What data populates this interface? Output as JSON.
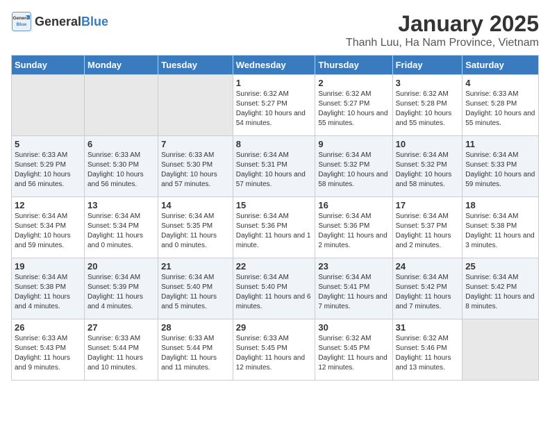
{
  "header": {
    "logo_general": "General",
    "logo_blue": "Blue",
    "title": "January 2025",
    "subtitle": "Thanh Luu, Ha Nam Province, Vietnam"
  },
  "columns": [
    "Sunday",
    "Monday",
    "Tuesday",
    "Wednesday",
    "Thursday",
    "Friday",
    "Saturday"
  ],
  "weeks": [
    [
      {
        "day": "",
        "sunrise": "",
        "sunset": "",
        "daylight": "",
        "empty": true
      },
      {
        "day": "",
        "sunrise": "",
        "sunset": "",
        "daylight": "",
        "empty": true
      },
      {
        "day": "",
        "sunrise": "",
        "sunset": "",
        "daylight": "",
        "empty": true
      },
      {
        "day": "1",
        "sunrise": "Sunrise: 6:32 AM",
        "sunset": "Sunset: 5:27 PM",
        "daylight": "Daylight: 10 hours and 54 minutes."
      },
      {
        "day": "2",
        "sunrise": "Sunrise: 6:32 AM",
        "sunset": "Sunset: 5:27 PM",
        "daylight": "Daylight: 10 hours and 55 minutes."
      },
      {
        "day": "3",
        "sunrise": "Sunrise: 6:32 AM",
        "sunset": "Sunset: 5:28 PM",
        "daylight": "Daylight: 10 hours and 55 minutes."
      },
      {
        "day": "4",
        "sunrise": "Sunrise: 6:33 AM",
        "sunset": "Sunset: 5:28 PM",
        "daylight": "Daylight: 10 hours and 55 minutes."
      }
    ],
    [
      {
        "day": "5",
        "sunrise": "Sunrise: 6:33 AM",
        "sunset": "Sunset: 5:29 PM",
        "daylight": "Daylight: 10 hours and 56 minutes."
      },
      {
        "day": "6",
        "sunrise": "Sunrise: 6:33 AM",
        "sunset": "Sunset: 5:30 PM",
        "daylight": "Daylight: 10 hours and 56 minutes."
      },
      {
        "day": "7",
        "sunrise": "Sunrise: 6:33 AM",
        "sunset": "Sunset: 5:30 PM",
        "daylight": "Daylight: 10 hours and 57 minutes."
      },
      {
        "day": "8",
        "sunrise": "Sunrise: 6:34 AM",
        "sunset": "Sunset: 5:31 PM",
        "daylight": "Daylight: 10 hours and 57 minutes."
      },
      {
        "day": "9",
        "sunrise": "Sunrise: 6:34 AM",
        "sunset": "Sunset: 5:32 PM",
        "daylight": "Daylight: 10 hours and 58 minutes."
      },
      {
        "day": "10",
        "sunrise": "Sunrise: 6:34 AM",
        "sunset": "Sunset: 5:32 PM",
        "daylight": "Daylight: 10 hours and 58 minutes."
      },
      {
        "day": "11",
        "sunrise": "Sunrise: 6:34 AM",
        "sunset": "Sunset: 5:33 PM",
        "daylight": "Daylight: 10 hours and 59 minutes."
      }
    ],
    [
      {
        "day": "12",
        "sunrise": "Sunrise: 6:34 AM",
        "sunset": "Sunset: 5:34 PM",
        "daylight": "Daylight: 10 hours and 59 minutes."
      },
      {
        "day": "13",
        "sunrise": "Sunrise: 6:34 AM",
        "sunset": "Sunset: 5:34 PM",
        "daylight": "Daylight: 11 hours and 0 minutes."
      },
      {
        "day": "14",
        "sunrise": "Sunrise: 6:34 AM",
        "sunset": "Sunset: 5:35 PM",
        "daylight": "Daylight: 11 hours and 0 minutes."
      },
      {
        "day": "15",
        "sunrise": "Sunrise: 6:34 AM",
        "sunset": "Sunset: 5:36 PM",
        "daylight": "Daylight: 11 hours and 1 minute."
      },
      {
        "day": "16",
        "sunrise": "Sunrise: 6:34 AM",
        "sunset": "Sunset: 5:36 PM",
        "daylight": "Daylight: 11 hours and 2 minutes."
      },
      {
        "day": "17",
        "sunrise": "Sunrise: 6:34 AM",
        "sunset": "Sunset: 5:37 PM",
        "daylight": "Daylight: 11 hours and 2 minutes."
      },
      {
        "day": "18",
        "sunrise": "Sunrise: 6:34 AM",
        "sunset": "Sunset: 5:38 PM",
        "daylight": "Daylight: 11 hours and 3 minutes."
      }
    ],
    [
      {
        "day": "19",
        "sunrise": "Sunrise: 6:34 AM",
        "sunset": "Sunset: 5:38 PM",
        "daylight": "Daylight: 11 hours and 4 minutes."
      },
      {
        "day": "20",
        "sunrise": "Sunrise: 6:34 AM",
        "sunset": "Sunset: 5:39 PM",
        "daylight": "Daylight: 11 hours and 4 minutes."
      },
      {
        "day": "21",
        "sunrise": "Sunrise: 6:34 AM",
        "sunset": "Sunset: 5:40 PM",
        "daylight": "Daylight: 11 hours and 5 minutes."
      },
      {
        "day": "22",
        "sunrise": "Sunrise: 6:34 AM",
        "sunset": "Sunset: 5:40 PM",
        "daylight": "Daylight: 11 hours and 6 minutes."
      },
      {
        "day": "23",
        "sunrise": "Sunrise: 6:34 AM",
        "sunset": "Sunset: 5:41 PM",
        "daylight": "Daylight: 11 hours and 7 minutes."
      },
      {
        "day": "24",
        "sunrise": "Sunrise: 6:34 AM",
        "sunset": "Sunset: 5:42 PM",
        "daylight": "Daylight: 11 hours and 7 minutes."
      },
      {
        "day": "25",
        "sunrise": "Sunrise: 6:34 AM",
        "sunset": "Sunset: 5:42 PM",
        "daylight": "Daylight: 11 hours and 8 minutes."
      }
    ],
    [
      {
        "day": "26",
        "sunrise": "Sunrise: 6:33 AM",
        "sunset": "Sunset: 5:43 PM",
        "daylight": "Daylight: 11 hours and 9 minutes."
      },
      {
        "day": "27",
        "sunrise": "Sunrise: 6:33 AM",
        "sunset": "Sunset: 5:44 PM",
        "daylight": "Daylight: 11 hours and 10 minutes."
      },
      {
        "day": "28",
        "sunrise": "Sunrise: 6:33 AM",
        "sunset": "Sunset: 5:44 PM",
        "daylight": "Daylight: 11 hours and 11 minutes."
      },
      {
        "day": "29",
        "sunrise": "Sunrise: 6:33 AM",
        "sunset": "Sunset: 5:45 PM",
        "daylight": "Daylight: 11 hours and 12 minutes."
      },
      {
        "day": "30",
        "sunrise": "Sunrise: 6:32 AM",
        "sunset": "Sunset: 5:45 PM",
        "daylight": "Daylight: 11 hours and 12 minutes."
      },
      {
        "day": "31",
        "sunrise": "Sunrise: 6:32 AM",
        "sunset": "Sunset: 5:46 PM",
        "daylight": "Daylight: 11 hours and 13 minutes."
      },
      {
        "day": "",
        "sunrise": "",
        "sunset": "",
        "daylight": "",
        "empty": true
      }
    ]
  ]
}
